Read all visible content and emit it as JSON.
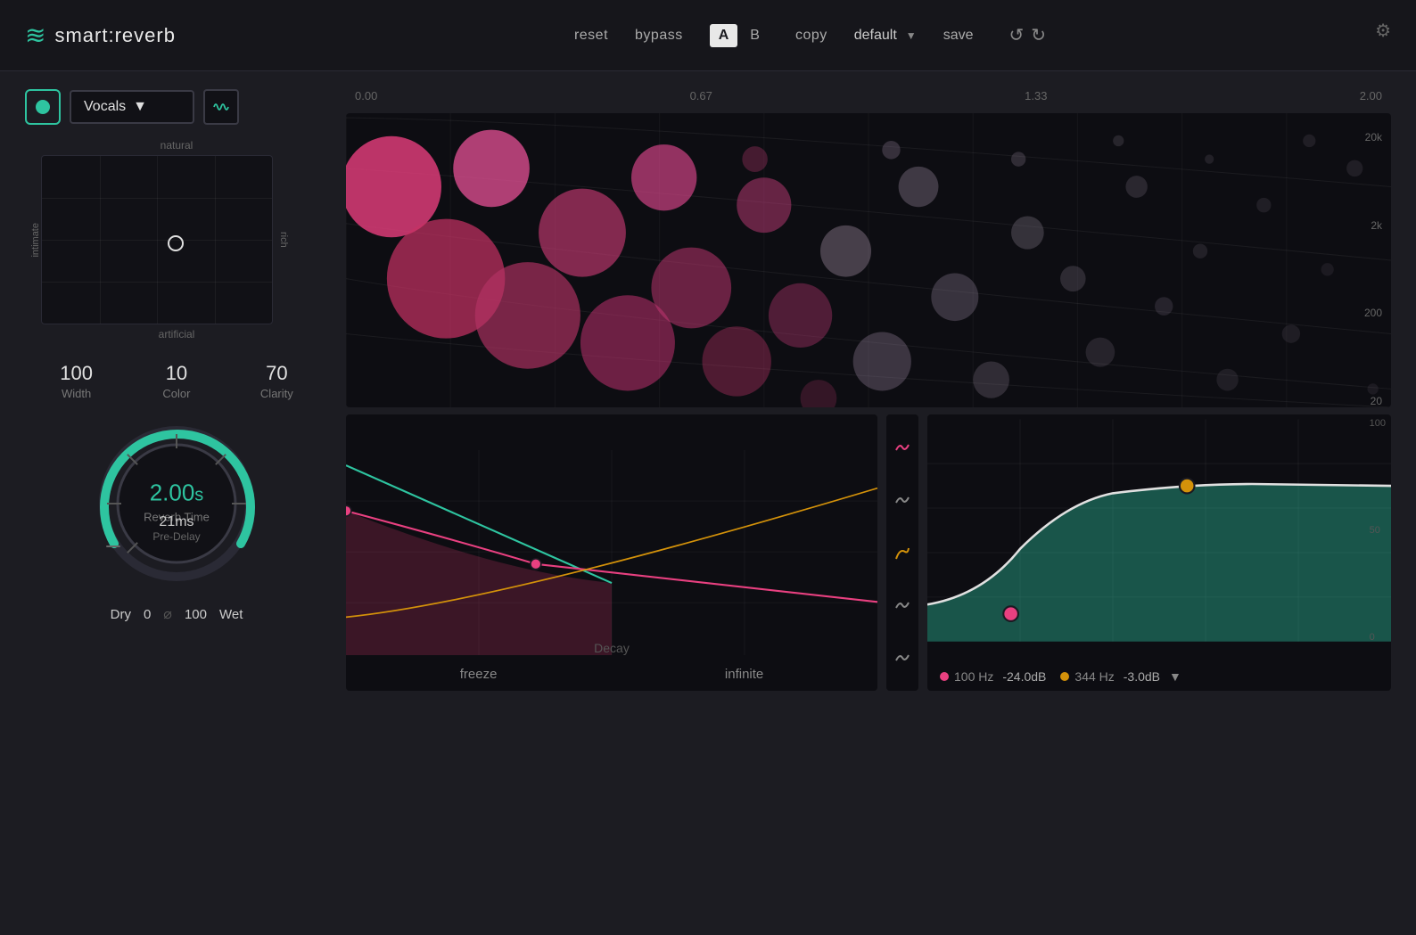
{
  "app": {
    "title": "smart:reverb",
    "logo_symbol": "≋"
  },
  "header": {
    "reset_label": "reset",
    "bypass_label": "bypass",
    "ab_a_label": "A",
    "ab_b_label": "B",
    "copy_label": "copy",
    "preset_name": "default",
    "preset_arrow": "▼",
    "save_label": "save",
    "undo_symbol": "↺",
    "redo_symbol": "↻",
    "settings_symbol": "⚙"
  },
  "instrument": {
    "name": "Vocals",
    "arrow": "▼"
  },
  "mood": {
    "label_top": "natural",
    "label_bottom": "artificial",
    "label_left": "intimate",
    "label_right": "rich"
  },
  "params": {
    "width_value": "100",
    "width_label": "Width",
    "color_value": "10",
    "color_label": "Color",
    "clarity_value": "70",
    "clarity_label": "Clarity"
  },
  "reverb": {
    "time_value": "2.00",
    "time_unit": "s",
    "time_label": "Reverb Time",
    "pre_delay_value": "21ms",
    "pre_delay_label": "Pre-Delay"
  },
  "dry_wet": {
    "dry_label": "Dry",
    "dry_value": "0",
    "wet_label": "Wet",
    "wet_value": "100"
  },
  "time_axis": {
    "t0": "0.00",
    "t1": "0.67",
    "t2": "1.33",
    "t3": "2.00"
  },
  "freq_axis": {
    "f0": "20k",
    "f1": "2k",
    "f2": "200",
    "f3": "20"
  },
  "decay": {
    "label": "Decay",
    "freeze_label": "freeze",
    "infinite_label": "infinite"
  },
  "eq": {
    "band1_freq": "100 Hz",
    "band1_gain": "-24.0dB",
    "band2_freq": "344 Hz",
    "band2_gain": "-3.0dB",
    "dropdown_arrow": "▼"
  },
  "colors": {
    "accent_teal": "#2ec4a0",
    "accent_pink": "#e84080",
    "accent_orange": "#d4920a",
    "bg_dark": "#0d0d12",
    "bg_mid": "#1c1c22"
  }
}
